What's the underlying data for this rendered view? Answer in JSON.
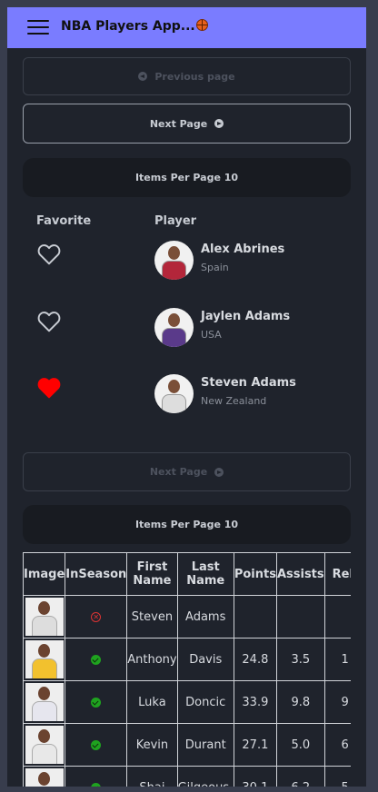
{
  "app": {
    "title": "NBA Players App..."
  },
  "pagination_top": {
    "previous_label": "Previous page",
    "next_label": "Next Page",
    "items_per_page_label": "Items Per Page 10"
  },
  "list": {
    "headers": {
      "favorite": "Favorite",
      "player": "Player"
    },
    "players": [
      {
        "name": "Alex Abrines",
        "country": "Spain",
        "favorite": false,
        "jersey_color": "#b3263a"
      },
      {
        "name": "Jaylen Adams",
        "country": "USA",
        "favorite": false,
        "jersey_color": "#5a3a8a"
      },
      {
        "name": "Steven Adams",
        "country": "New Zealand",
        "favorite": true,
        "jersey_color": "#dddddd"
      }
    ]
  },
  "pagination_bottom": {
    "next_label": "Next Page",
    "items_per_page_label": "Items Per Page 10"
  },
  "table": {
    "headers": {
      "image": "Image",
      "inseason": "InSeason",
      "first_name": "First Name",
      "last_name": "Last Name",
      "points": "Points",
      "assists": "Assists",
      "rebounds": "Reb"
    },
    "rows": [
      {
        "first": "Steven",
        "last": "Adams",
        "in_season": false,
        "points": "",
        "assists": "",
        "rebounds": "",
        "jersey_color": "#dddddd"
      },
      {
        "first": "Anthony",
        "last": "Davis",
        "in_season": true,
        "points": "24.8",
        "assists": "3.5",
        "rebounds": "1",
        "jersey_color": "#f2c12e"
      },
      {
        "first": "Luka",
        "last": "Doncic",
        "in_season": true,
        "points": "33.9",
        "assists": "9.8",
        "rebounds": "9",
        "jersey_color": "#e6e6ee"
      },
      {
        "first": "Kevin",
        "last": "Durant",
        "in_season": true,
        "points": "27.1",
        "assists": "5.0",
        "rebounds": "6",
        "jersey_color": "#e8e8e8"
      },
      {
        "first": "Shai",
        "last": "Gilgeous-",
        "in_season": true,
        "points": "30.1",
        "assists": "6.2",
        "rebounds": "5",
        "jersey_color": "#e06a2a"
      }
    ]
  },
  "colors": {
    "app_bar": "#7a7cff",
    "background": "#1f232c",
    "favorite_heart": "#ff0000",
    "in_season_check": "#1fa31f",
    "not_in_season": "#dd3333"
  }
}
